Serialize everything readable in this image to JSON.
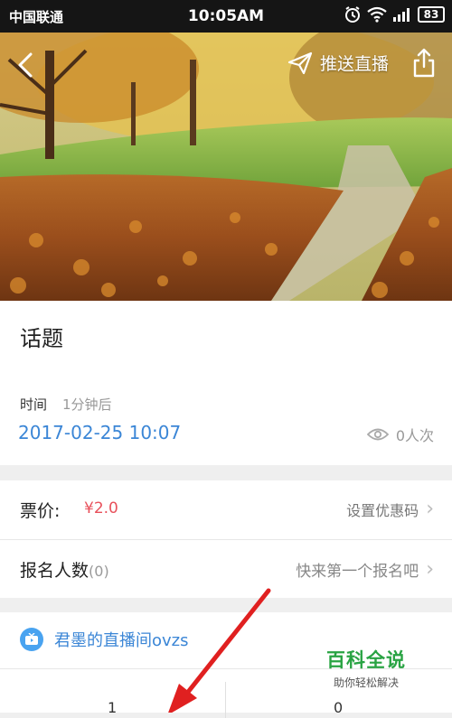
{
  "status_bar": {
    "carrier": "中国联通",
    "time": "10:05AM",
    "battery": "83"
  },
  "header": {
    "push_live_label": "推送直播",
    "icons": [
      "back-arrow-icon",
      "send-icon",
      "share-icon"
    ]
  },
  "topic": {
    "title": "话题",
    "time_label": "时间",
    "time_relative": "1分钟后",
    "datetime": "2017-02-25 10:07",
    "view_count": "0人次"
  },
  "ticket": {
    "price_label": "票价:",
    "price_value": "¥2.0",
    "promo_label": "设置优惠码"
  },
  "signup": {
    "label": "报名人数",
    "count": "(0)",
    "hint": "快来第一个报名吧"
  },
  "live_room": {
    "name": "君墨的直播间ovzs"
  },
  "stats": {
    "left_value": "1",
    "right_value": "0"
  },
  "watermark": {
    "title": "百科全说",
    "subtitle": "助你轻松解决"
  },
  "colors": {
    "link_blue": "#3b86d6",
    "price_red": "#e8515b",
    "annotation_red": "#e02020",
    "watermark_green": "#29a343"
  }
}
